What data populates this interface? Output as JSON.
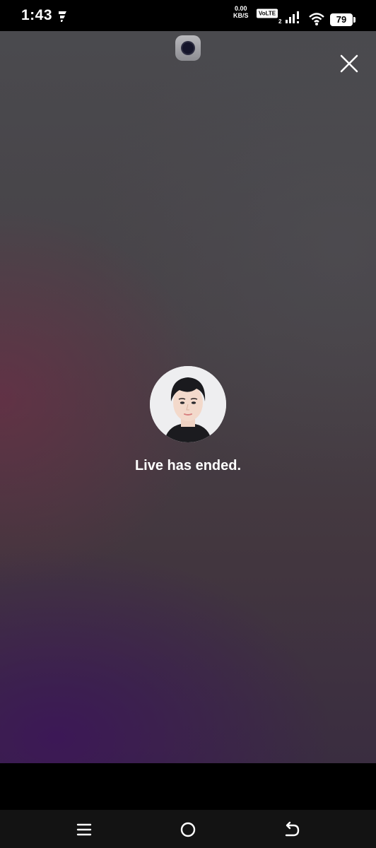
{
  "status_bar": {
    "time": "1:43",
    "net_speed_value": "0.00",
    "net_speed_unit": "KB/S",
    "volte_label": "VoLTE",
    "volte_sim": "2",
    "battery_level": "79"
  },
  "live": {
    "ended_message": "Live has ended."
  },
  "icons": {
    "close": "close-icon",
    "menu": "menu-icon",
    "home": "home-icon",
    "back": "back-icon"
  },
  "colors": {
    "text": "#ffffff",
    "background_top": "#4a4a4e",
    "background_purple": "#3a2d40"
  }
}
